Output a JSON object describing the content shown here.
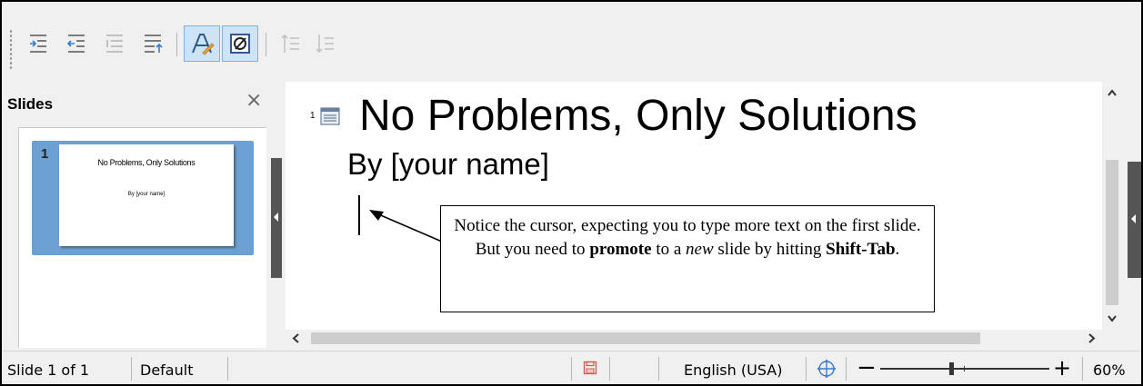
{
  "toolbar": {
    "buttons": [
      {
        "name": "demote-icon",
        "active": false,
        "enabled": true
      },
      {
        "name": "promote-icon",
        "active": false,
        "enabled": true
      },
      {
        "name": "move-down-level-icon",
        "active": false,
        "enabled": false
      },
      {
        "name": "move-up-icon",
        "active": false,
        "enabled": true
      },
      {
        "name": "formatting-on-off-icon",
        "active": true,
        "enabled": true
      },
      {
        "name": "black-white-icon",
        "active": true,
        "enabled": true
      },
      {
        "name": "move-up-disabled-icon",
        "active": false,
        "enabled": false
      },
      {
        "name": "move-down-disabled-icon",
        "active": false,
        "enabled": false
      }
    ]
  },
  "slides_pane": {
    "title": "Slides",
    "close_glyph": "×",
    "thumbnails": [
      {
        "number": "1",
        "title": "No Problems, Only Solutions",
        "subtitle": "By [your name]"
      }
    ]
  },
  "outline": {
    "level_number": "1",
    "title": "No Problems, Only Solutions",
    "subtitle": "By [your name]"
  },
  "callout": {
    "part1": "Notice the cursor, expecting you to type more text on the first slide. But you need to ",
    "promote": "promote",
    "part2": " to a ",
    "new_word": "new",
    "part3": " slide by hitting ",
    "shortcut": "Shift-Tab",
    "part4": "."
  },
  "statusbar": {
    "slide_info": "Slide 1 of 1",
    "layout": "Default",
    "language": "English (USA)",
    "zoom": "60%",
    "zoom_minus": "−",
    "zoom_plus": "+",
    "zoom_level": 0.42
  },
  "colors": {
    "accent": "#6c9fd2",
    "active_button_bg": "#cfe3f6",
    "save_icon": "#d9534f",
    "nav_icon": "#3a7bd5"
  }
}
